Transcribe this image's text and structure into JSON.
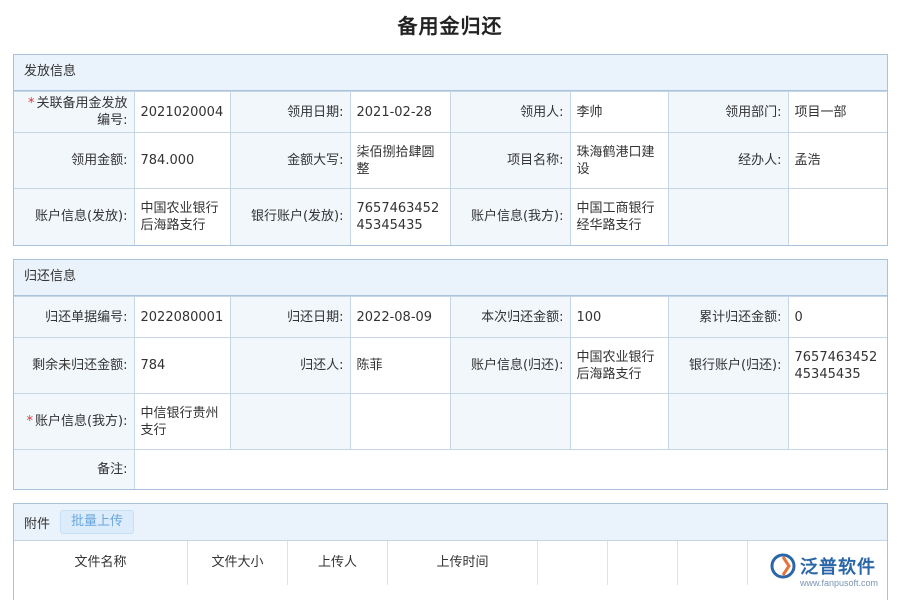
{
  "title": "备用金归还",
  "issue": {
    "header": "发放信息",
    "rows": [
      [
        {
          "label": "关联备用金发放编号:",
          "required": true,
          "value": "2021020004"
        },
        {
          "label": "领用日期:",
          "value": "2021-02-28"
        },
        {
          "label": "领用人:",
          "value": "李帅"
        },
        {
          "label": "领用部门:",
          "value": "项目一部"
        }
      ],
      [
        {
          "label": "领用金额:",
          "value": "784.000"
        },
        {
          "label": "金额大写:",
          "value": "柒佰捌拾肆圆整"
        },
        {
          "label": "项目名称:",
          "value": "珠海鹤港口建设"
        },
        {
          "label": "经办人:",
          "value": "孟浩"
        }
      ],
      [
        {
          "label": "账户信息(发放):",
          "value": "中国农业银行后海路支行"
        },
        {
          "label": "银行账户(发放):",
          "value": "765746345245345435"
        },
        {
          "label": "账户信息(我方):",
          "value": "中国工商银行经华路支行"
        },
        {
          "label": "",
          "value": ""
        }
      ]
    ]
  },
  "ret": {
    "header": "归还信息",
    "rows": [
      [
        {
          "label": "归还单据编号:",
          "value": "2022080001"
        },
        {
          "label": "归还日期:",
          "value": "2022-08-09"
        },
        {
          "label": "本次归还金额:",
          "value": "100"
        },
        {
          "label": "累计归还金额:",
          "value": "0"
        }
      ],
      [
        {
          "label": "剩余未归还金额:",
          "value": "784"
        },
        {
          "label": "归还人:",
          "value": "陈菲"
        },
        {
          "label": "账户信息(归还):",
          "value": "中国农业银行后海路支行"
        },
        {
          "label": "银行账户(归还):",
          "value": "765746345245345435"
        }
      ],
      [
        {
          "label": "账户信息(我方):",
          "required": true,
          "value": "中信银行贵州支行"
        },
        {
          "label": "",
          "value": ""
        },
        {
          "label": "",
          "value": ""
        },
        {
          "label": "",
          "value": ""
        }
      ]
    ],
    "remark_label": "备注:",
    "remark_value": ""
  },
  "attachments": {
    "header": "附件",
    "upload_label": "批量上传",
    "columns": [
      "文件名称",
      "文件大小",
      "上传人",
      "上传时间",
      "",
      "",
      "",
      ""
    ]
  },
  "logo": {
    "name": "泛普软件",
    "url": "www.fanpusoft.com"
  },
  "colors": {
    "section_border": "#a9c3dc",
    "header_bg": "#eaf2fb",
    "label_bg": "#f2f7fc",
    "required": "#e53333",
    "brand": "#2b66a8"
  }
}
